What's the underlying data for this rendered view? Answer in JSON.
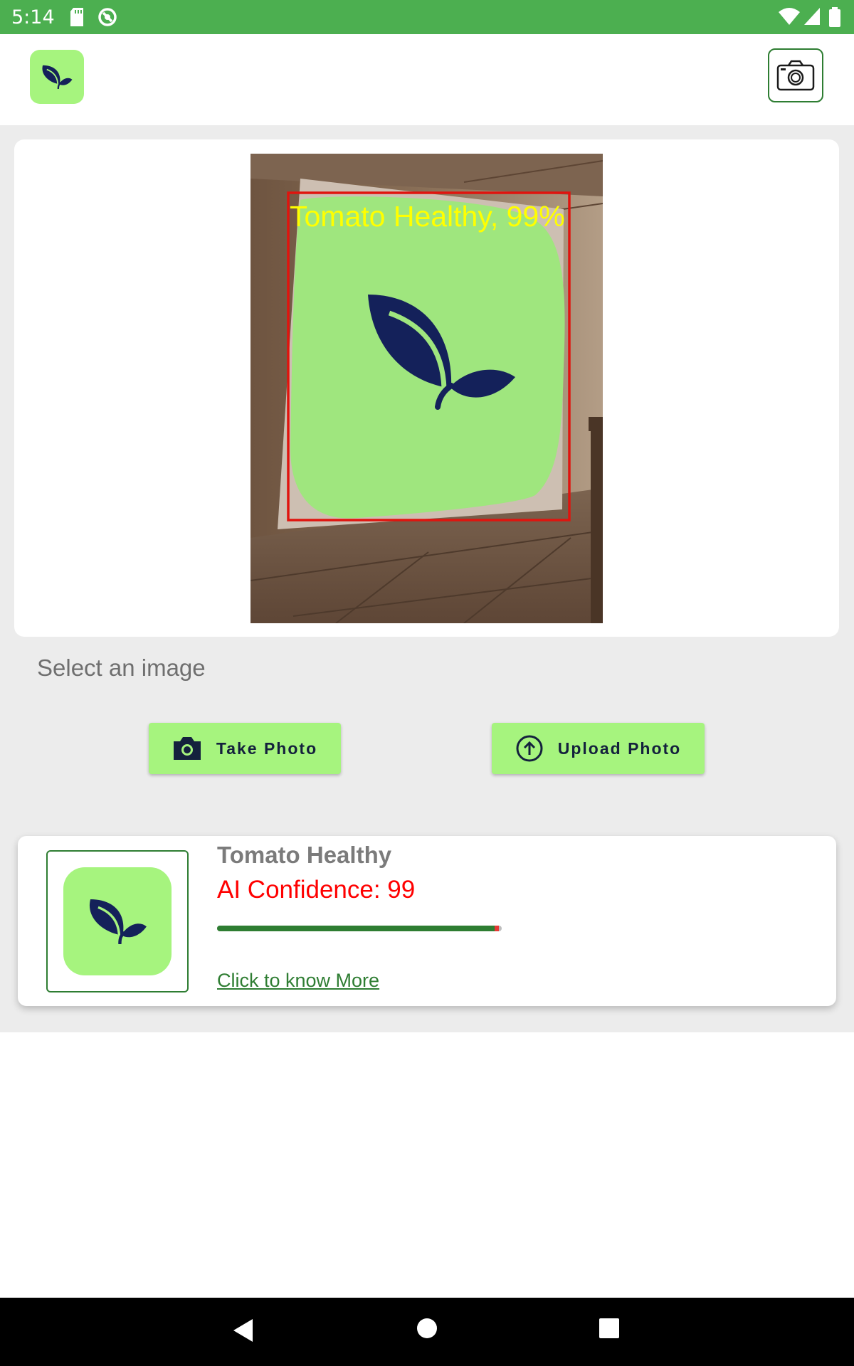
{
  "status_bar": {
    "time": "5:14"
  },
  "detection": {
    "label": "Tomato Healthy, 99%"
  },
  "select_label": "Select an image",
  "buttons": {
    "take_photo": "Take Photo",
    "upload_photo": "Upload Photo"
  },
  "result": {
    "title": "Tomato Healthy",
    "confidence_text": "AI Confidence: 99",
    "confidence_value": 99,
    "link": "Click to know More"
  },
  "colors": {
    "status_bar": "#4caf50",
    "accent_light": "#a6f47e",
    "accent_dark": "#2e7d32",
    "leaf": "#14215a",
    "confidence": "#ff0000"
  },
  "icons": [
    "leaf-icon",
    "camera-icon",
    "upload-icon",
    "wifi-icon",
    "signal-icon",
    "battery-icon",
    "sd-card-icon",
    "sync-icon",
    "back-icon",
    "home-icon",
    "recents-icon"
  ]
}
